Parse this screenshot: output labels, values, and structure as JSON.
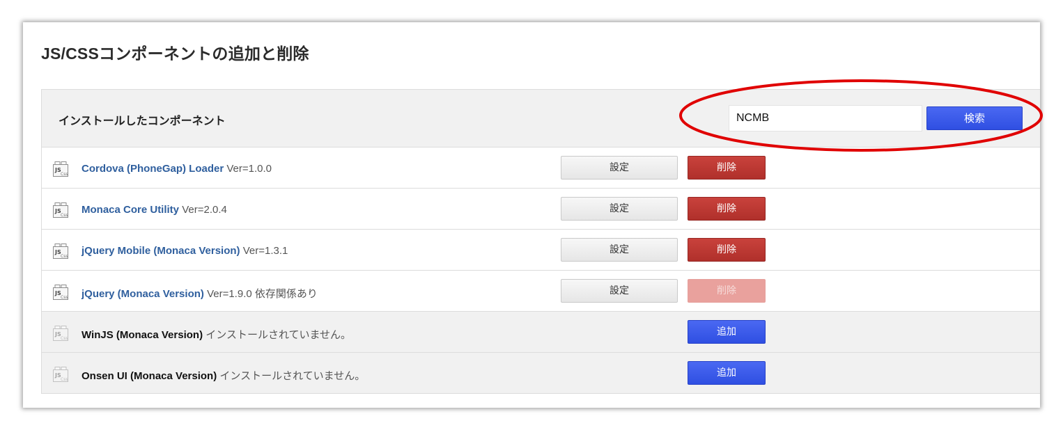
{
  "page_title": "JS/CSSコンポーネントの追加と削除",
  "table": {
    "header_title": "インストールしたコンポーネント",
    "search": {
      "value": "NCMB",
      "button_label": "検索"
    }
  },
  "rows": [
    {
      "name": "Cordova (PhoneGap) Loader",
      "version": "Ver=1.0.0",
      "status": "installed",
      "settings_label": "設定",
      "delete_label": "削除",
      "delete_enabled": true
    },
    {
      "name": "Monaca Core Utility",
      "version": "Ver=2.0.4",
      "status": "installed",
      "settings_label": "設定",
      "delete_label": "削除",
      "delete_enabled": true
    },
    {
      "name": "jQuery Mobile (Monaca Version)",
      "version": "Ver=1.3.1",
      "status": "installed",
      "settings_label": "設定",
      "delete_label": "削除",
      "delete_enabled": true
    },
    {
      "name": "jQuery (Monaca Version)",
      "version": "Ver=1.9.0 依存関係あり",
      "status": "installed",
      "settings_label": "設定",
      "delete_label": "削除",
      "delete_enabled": false
    },
    {
      "name": "WinJS (Monaca Version)",
      "version": "インストールされていません。",
      "status": "not-installed",
      "add_label": "追加"
    },
    {
      "name": "Onsen UI (Monaca Version)",
      "version": "インストールされていません。",
      "status": "not-installed",
      "add_label": "追加"
    }
  ],
  "icon": "js-css-component-icon",
  "colors": {
    "link": "#2f5f9e",
    "primary_button": "#3857e8",
    "delete_button": "#bb3933",
    "highlight": "#e00000"
  }
}
